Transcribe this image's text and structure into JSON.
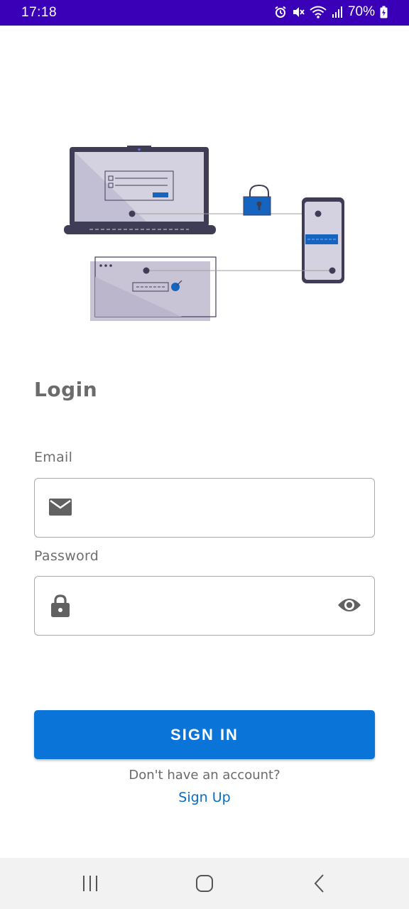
{
  "status_bar": {
    "time": "17:18",
    "battery": "70%",
    "icons": [
      "alarm-icon",
      "mute-icon",
      "wifi-icon",
      "signal-icon",
      "battery-icon"
    ],
    "background_color": "#3a00b8"
  },
  "illustration": {
    "name": "secure-login-devices-illustration"
  },
  "login": {
    "title": "Login",
    "email_label": "Email",
    "email_value": "",
    "password_label": "Password",
    "password_value": "",
    "sign_in_label": "SIGN IN",
    "no_account_text": "Don't have an account?",
    "sign_up_label": "Sign Up"
  },
  "colors": {
    "primary": "#0a74d8",
    "link": "#0a6cc4",
    "text": "#6b6b6b"
  },
  "nav_bar": {
    "buttons": [
      "recent-apps-icon",
      "home-icon",
      "back-icon"
    ]
  }
}
